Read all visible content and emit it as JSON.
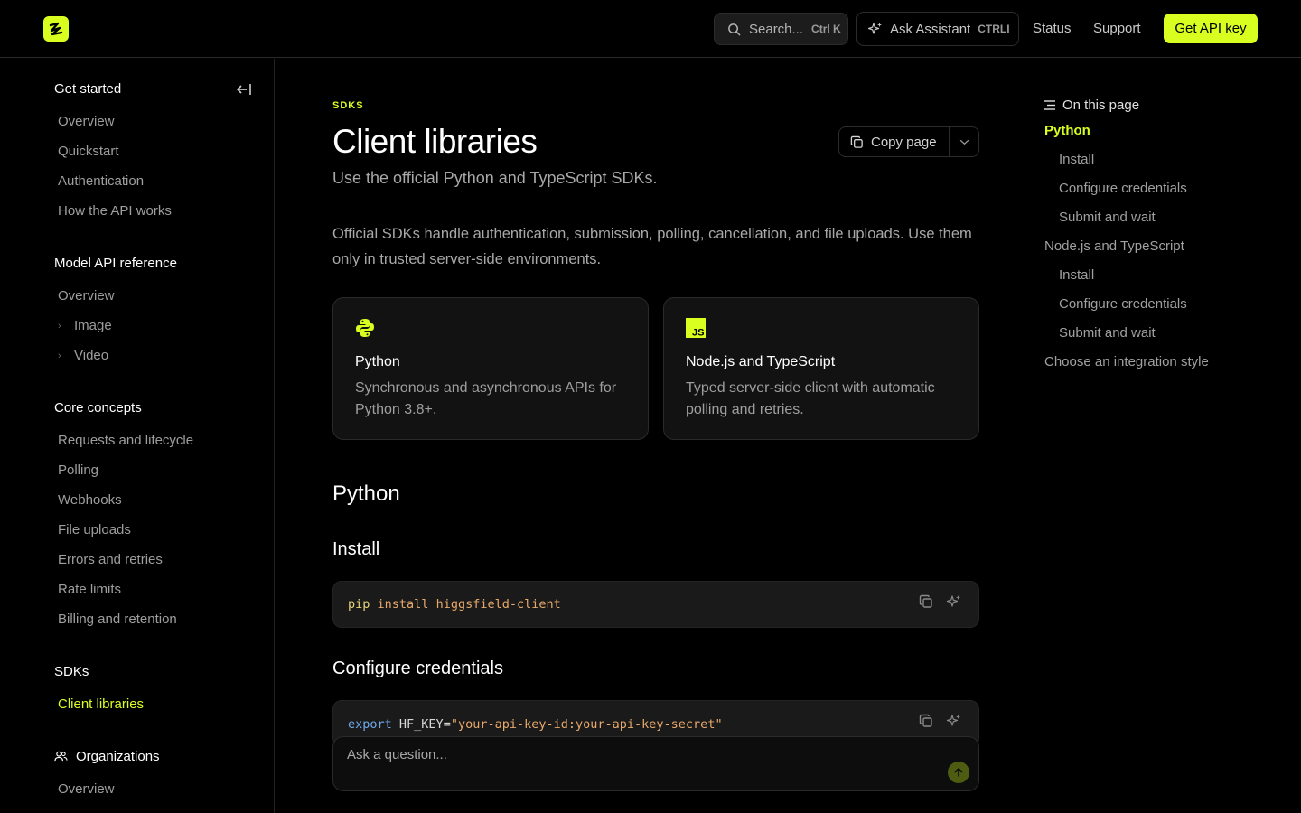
{
  "colors": {
    "accent": "#d8ff1f",
    "background": "#000000",
    "card": "#121212"
  },
  "topbar": {
    "search_label": "Search...",
    "search_kbd": "Ctrl K",
    "assistant_label": "Ask Assistant",
    "assistant_kbd": "CTRLI",
    "status_link": "Status",
    "support_link": "Support",
    "api_key_button": "Get API key"
  },
  "sidebar": {
    "sections": [
      {
        "title": "Get started",
        "items": [
          "Overview",
          "Quickstart",
          "Authentication",
          "How the API works"
        ]
      },
      {
        "title": "Model API reference",
        "items": [
          "Overview",
          "Image",
          "Video"
        ]
      },
      {
        "title": "Core concepts",
        "items": [
          "Requests and lifecycle",
          "Polling",
          "Webhooks",
          "File uploads",
          "Errors and retries",
          "Rate limits",
          "Billing and retention"
        ]
      },
      {
        "title": "SDKs",
        "items": [
          "Client libraries"
        ],
        "active": "Client libraries"
      },
      {
        "title": "Organizations",
        "items": [
          "Overview"
        ]
      }
    ]
  },
  "main": {
    "eyebrow": "SDKS",
    "title": "Client libraries",
    "subtitle": "Use the official Python and TypeScript SDKs.",
    "copy_page": "Copy page",
    "intro": "Official SDKs handle authentication, submission, polling, cancellation, and file uploads. Use them only in trusted server-side environments.",
    "cards": [
      {
        "icon": "python-icon",
        "title": "Python",
        "desc": "Synchronous and asynchronous APIs for Python 3.8+."
      },
      {
        "icon": "javascript-icon",
        "title": "Node.js and TypeScript",
        "desc": "Typed server-side client with automatic polling and retries."
      }
    ],
    "python_heading": "Python",
    "install_heading": "Install",
    "install_code": {
      "cmd": "pip",
      "sub": "install",
      "pkg": "higgsfield-client"
    },
    "credentials_heading": "Configure credentials",
    "credentials_code": {
      "kw": "export",
      "var": "HF_KEY",
      "eq": "=",
      "val": "\"your-api-key-id:your-api-key-secret\""
    },
    "ask_placeholder": "Ask a question..."
  },
  "toc": {
    "heading": "On this page",
    "items": [
      {
        "label": "Python",
        "level": 1,
        "active": true
      },
      {
        "label": "Install",
        "level": 2
      },
      {
        "label": "Configure credentials",
        "level": 2
      },
      {
        "label": "Submit and wait",
        "level": 2
      },
      {
        "label": "Node.js and TypeScript",
        "level": 1
      },
      {
        "label": "Install",
        "level": 2
      },
      {
        "label": "Configure credentials",
        "level": 2
      },
      {
        "label": "Submit and wait",
        "level": 2
      },
      {
        "label": "Choose an integration style",
        "level": 1
      }
    ]
  }
}
